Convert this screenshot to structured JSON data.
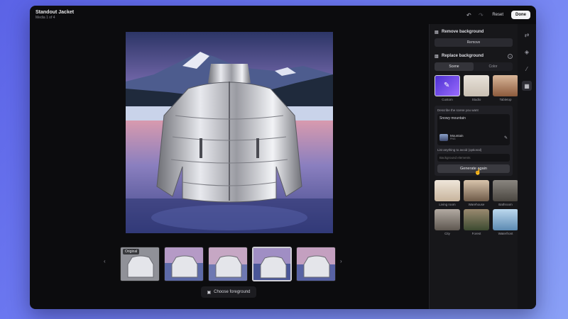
{
  "window": {
    "title": "Standout Jacket",
    "subtitle": "Media 1 of 4"
  },
  "toolbar": {
    "undo_icon": "undo-icon",
    "redo_icon": "redo-icon",
    "reset_label": "Reset",
    "done_label": "Done"
  },
  "thumbnails": {
    "original_tag": "Original",
    "selected_index": 3
  },
  "choose_foreground": {
    "label": "Choose foreground"
  },
  "panel": {
    "remove_bg": {
      "title": "Remove background",
      "button": "Remove"
    },
    "replace_bg": {
      "title": "Replace background",
      "tabs": [
        {
          "label": "Scene",
          "active": true
        },
        {
          "label": "Color",
          "active": false
        }
      ],
      "scenes_top": [
        {
          "label": "Custom",
          "selected": true
        },
        {
          "label": "Studio",
          "selected": false
        },
        {
          "label": "Tabletop",
          "selected": false
        }
      ],
      "describe_label": "Describe the scene you want",
      "describe_value": "Snowy mountain",
      "reference": {
        "name": "Mountain",
        "sub": "PNG"
      },
      "avoid_label": "List anything to avoid (optional)",
      "avoid_placeholder": "Background elements",
      "generate_label": "Generate again",
      "scenes_grid": [
        {
          "label": "Living room"
        },
        {
          "label": "Warehouse"
        },
        {
          "label": "Bathroom"
        },
        {
          "label": "City"
        },
        {
          "label": "Forest"
        },
        {
          "label": "Waterfront"
        }
      ]
    }
  },
  "colors": {
    "accent": "#7b5cff",
    "panel_bg": "#17171a",
    "window_bg": "#0c0c0e"
  }
}
